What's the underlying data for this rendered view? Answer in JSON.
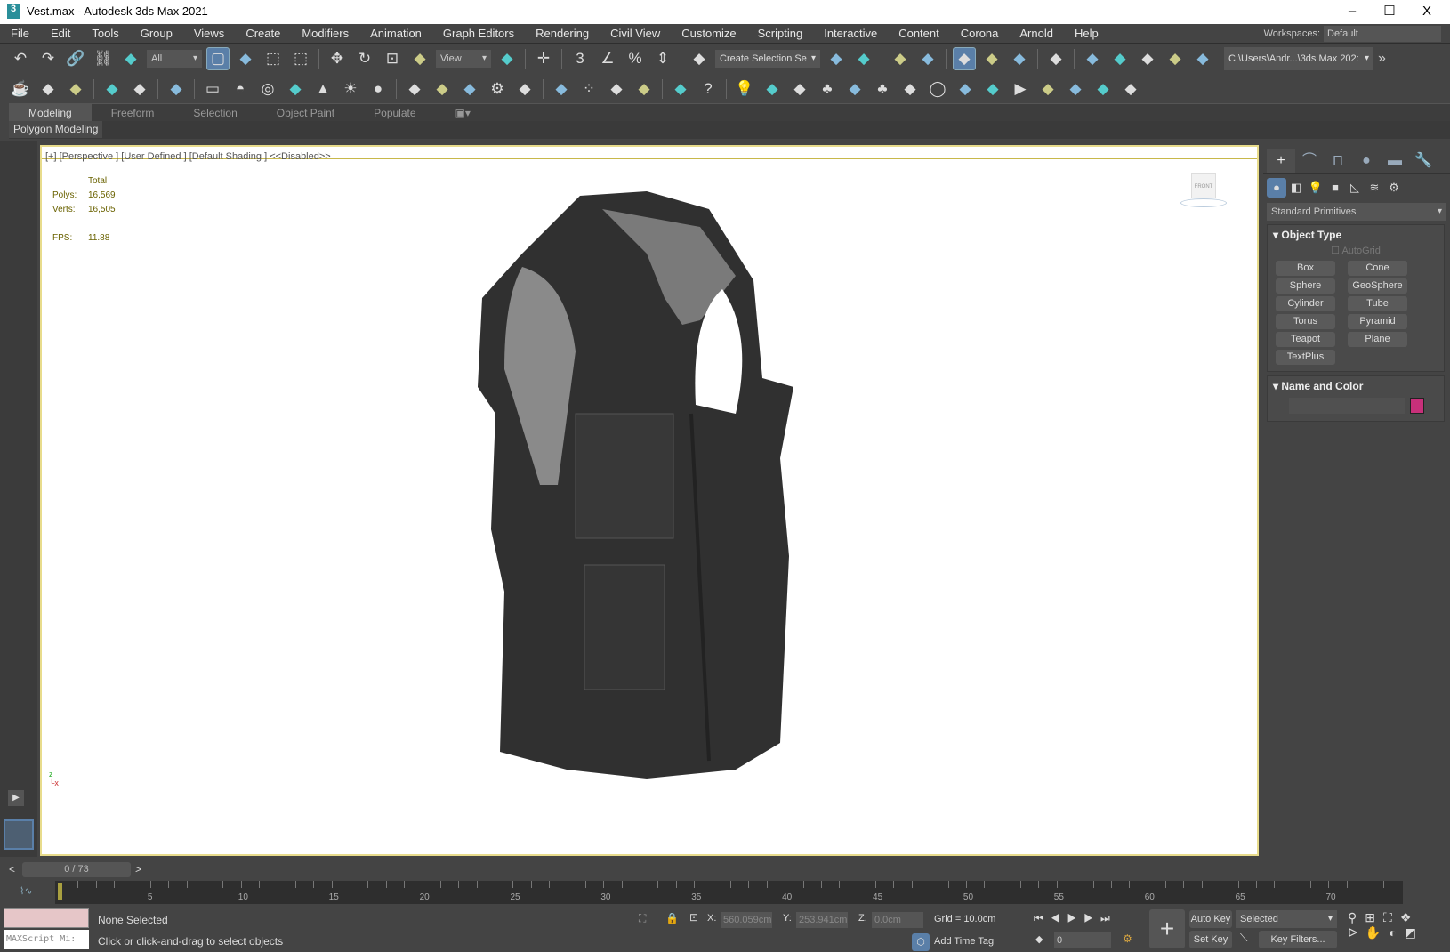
{
  "window": {
    "title": "Vest.max - Autodesk 3ds Max 2021",
    "app_icon": "3",
    "minimize": "–",
    "maximize": "☐",
    "close": "X"
  },
  "menu": [
    "File",
    "Edit",
    "Tools",
    "Group",
    "Views",
    "Create",
    "Modifiers",
    "Animation",
    "Graph Editors",
    "Rendering",
    "Civil View",
    "Customize",
    "Scripting",
    "Interactive",
    "Content",
    "Corona",
    "Arnold",
    "Help"
  ],
  "workspaces": {
    "label": "Workspaces:",
    "value": "Default"
  },
  "toolbar": {
    "filter": "All",
    "ref_coord": "View",
    "named_sel": "Create Selection Se",
    "path": "C:\\Users\\Andr...\\3ds Max 202:",
    "more": "»",
    "icons1": [
      "undo-icon",
      "redo-icon",
      "link-icon",
      "unlink-icon",
      "bind-spacewarp-icon",
      "|filter",
      "select-object-icon",
      "select-by-name-icon",
      "rect-region-icon",
      "window-crossing-icon",
      "|",
      "move-icon",
      "rotate-icon",
      "scale-icon",
      "placement-icon",
      "|refcoord",
      "pivot-icon",
      "|",
      "snap-toggle-icon",
      "|",
      "snap-3d-icon",
      "angle-snap-icon",
      "percent-snap-icon",
      "spinner-snap-icon",
      "|",
      "edit-named-sel-icon",
      "|namedsel",
      "mirror-icon",
      "align-icon",
      "|",
      "scene-explorer-icon",
      "layer-explorer-icon",
      "|",
      "toggle-ribbon-icon",
      "curve-editor-icon",
      "dope-sheet-icon",
      "|",
      "render-setup-icon",
      "|",
      "render-frame-icon",
      "render-icon",
      "render-iterative-icon",
      "render-cloud-icon",
      "a360-gallery-icon",
      "|path"
    ],
    "icons2": [
      "teapot-icon",
      "arnold-icon",
      "render-window-icon",
      "|",
      "light-icon",
      "camera-icon",
      "|",
      "camera-film-icon",
      "|",
      "plane-icon",
      "dome-icon",
      "disc-icon",
      "teapot2-icon",
      "cone-icon",
      "sun-icon",
      "sphere-icon",
      "|",
      "particles-icon",
      "molecule-icon",
      "truss-icon",
      "gear-icon",
      "grass-icon",
      "|",
      "material-sphere-icon",
      "palette-icon",
      "photo-icon",
      "material-icon",
      "|",
      "clipboard-icon",
      "help-icon",
      "|",
      "light-bulb-icon",
      "sun-light-icon",
      "video-camera-icon",
      "trees-icon",
      "book-icon",
      "tree-icon",
      "tree-card-icon",
      "ring-icon",
      "layers-icon",
      "frame-icon",
      "play-icon",
      "camera-add-icon",
      "window-icon",
      "teapot3-icon",
      "bulb-icon"
    ]
  },
  "glyphs": {
    "undo-icon": "↶",
    "redo-icon": "↷",
    "link-icon": "🔗",
    "unlink-icon": "⛓",
    "move-icon": "✥",
    "rotate-icon": "↻",
    "scale-icon": "⊡",
    "snap-toggle-icon": "✛",
    "snap-3d-icon": "3",
    "angle-snap-icon": "∠",
    "percent-snap-icon": "%",
    "spinner-snap-icon": "⇕",
    "help-icon": "?",
    "sun-icon": "☀",
    "cone-icon": "▲",
    "sphere-icon": "●",
    "teapot-icon": "☕",
    "light-bulb-icon": "💡",
    "gear-icon": "⚙",
    "ring-icon": "◯",
    "play-icon": "▶",
    "tree-icon": "♣",
    "trees-icon": "♣",
    "palette-icon": "⁘",
    "disc-icon": "◎",
    "dome-icon": "◓",
    "plane-icon": "▭",
    "select-object-icon": "▢",
    "rect-region-icon": "⬚",
    "window-crossing-icon": "⬚"
  },
  "ribbon": {
    "tabs": [
      "Modeling",
      "Freeform",
      "Selection",
      "Object Paint",
      "Populate"
    ],
    "active": 0,
    "panel": "Polygon Modeling"
  },
  "viewport": {
    "label": "[+] [Perspective ] [User Defined ] [Default Shading ]  <<Disabled>>",
    "stats": {
      "header": "Total",
      "polys_label": "Polys:",
      "polys": "16,569",
      "verts_label": "Verts:",
      "verts": "16,505",
      "fps_label": "FPS:",
      "fps": "11.88"
    },
    "viewcube": "FRONT"
  },
  "command_panel": {
    "tabs": [
      "create-icon",
      "modify-icon",
      "hierarchy-icon",
      "motion-icon",
      "display-icon",
      "utilities-icon"
    ],
    "subtabs": [
      "geometry-icon",
      "shapes-icon",
      "lights-icon",
      "cameras-icon",
      "helpers-icon",
      "spacewarps-icon",
      "systems-icon"
    ],
    "category": "Standard Primitives",
    "object_type": {
      "title": "Object Type",
      "autogrid": "AutoGrid",
      "buttons": [
        "Box",
        "Cone",
        "Sphere",
        "GeoSphere",
        "Cylinder",
        "Tube",
        "Torus",
        "Pyramid",
        "Teapot",
        "Plane",
        "TextPlus"
      ]
    },
    "name_color": {
      "title": "Name and Color",
      "value": "",
      "color": "#c8307a"
    }
  },
  "timeline": {
    "frame": "0 / 73",
    "prev": "<",
    "next": ">",
    "end": 73,
    "labels": [
      5,
      10,
      15,
      20,
      25,
      30,
      35,
      40,
      45,
      50,
      55,
      60,
      65,
      70
    ]
  },
  "status": {
    "maxscript": "MAXScript Mi:",
    "selection": "None Selected",
    "prompt": "Click or click-and-drag to select objects",
    "x_label": "X:",
    "x": "560.059cm",
    "y_label": "Y:",
    "y": "253.941cm",
    "z_label": "Z:",
    "z": "0.0cm",
    "grid": "Grid = 10.0cm",
    "time_tag": "Add Time Tag",
    "frame_value": "0",
    "auto_key": "Auto Key",
    "set_key": "Set Key",
    "key_mode": "Selected",
    "key_filters": "Key Filters..."
  }
}
